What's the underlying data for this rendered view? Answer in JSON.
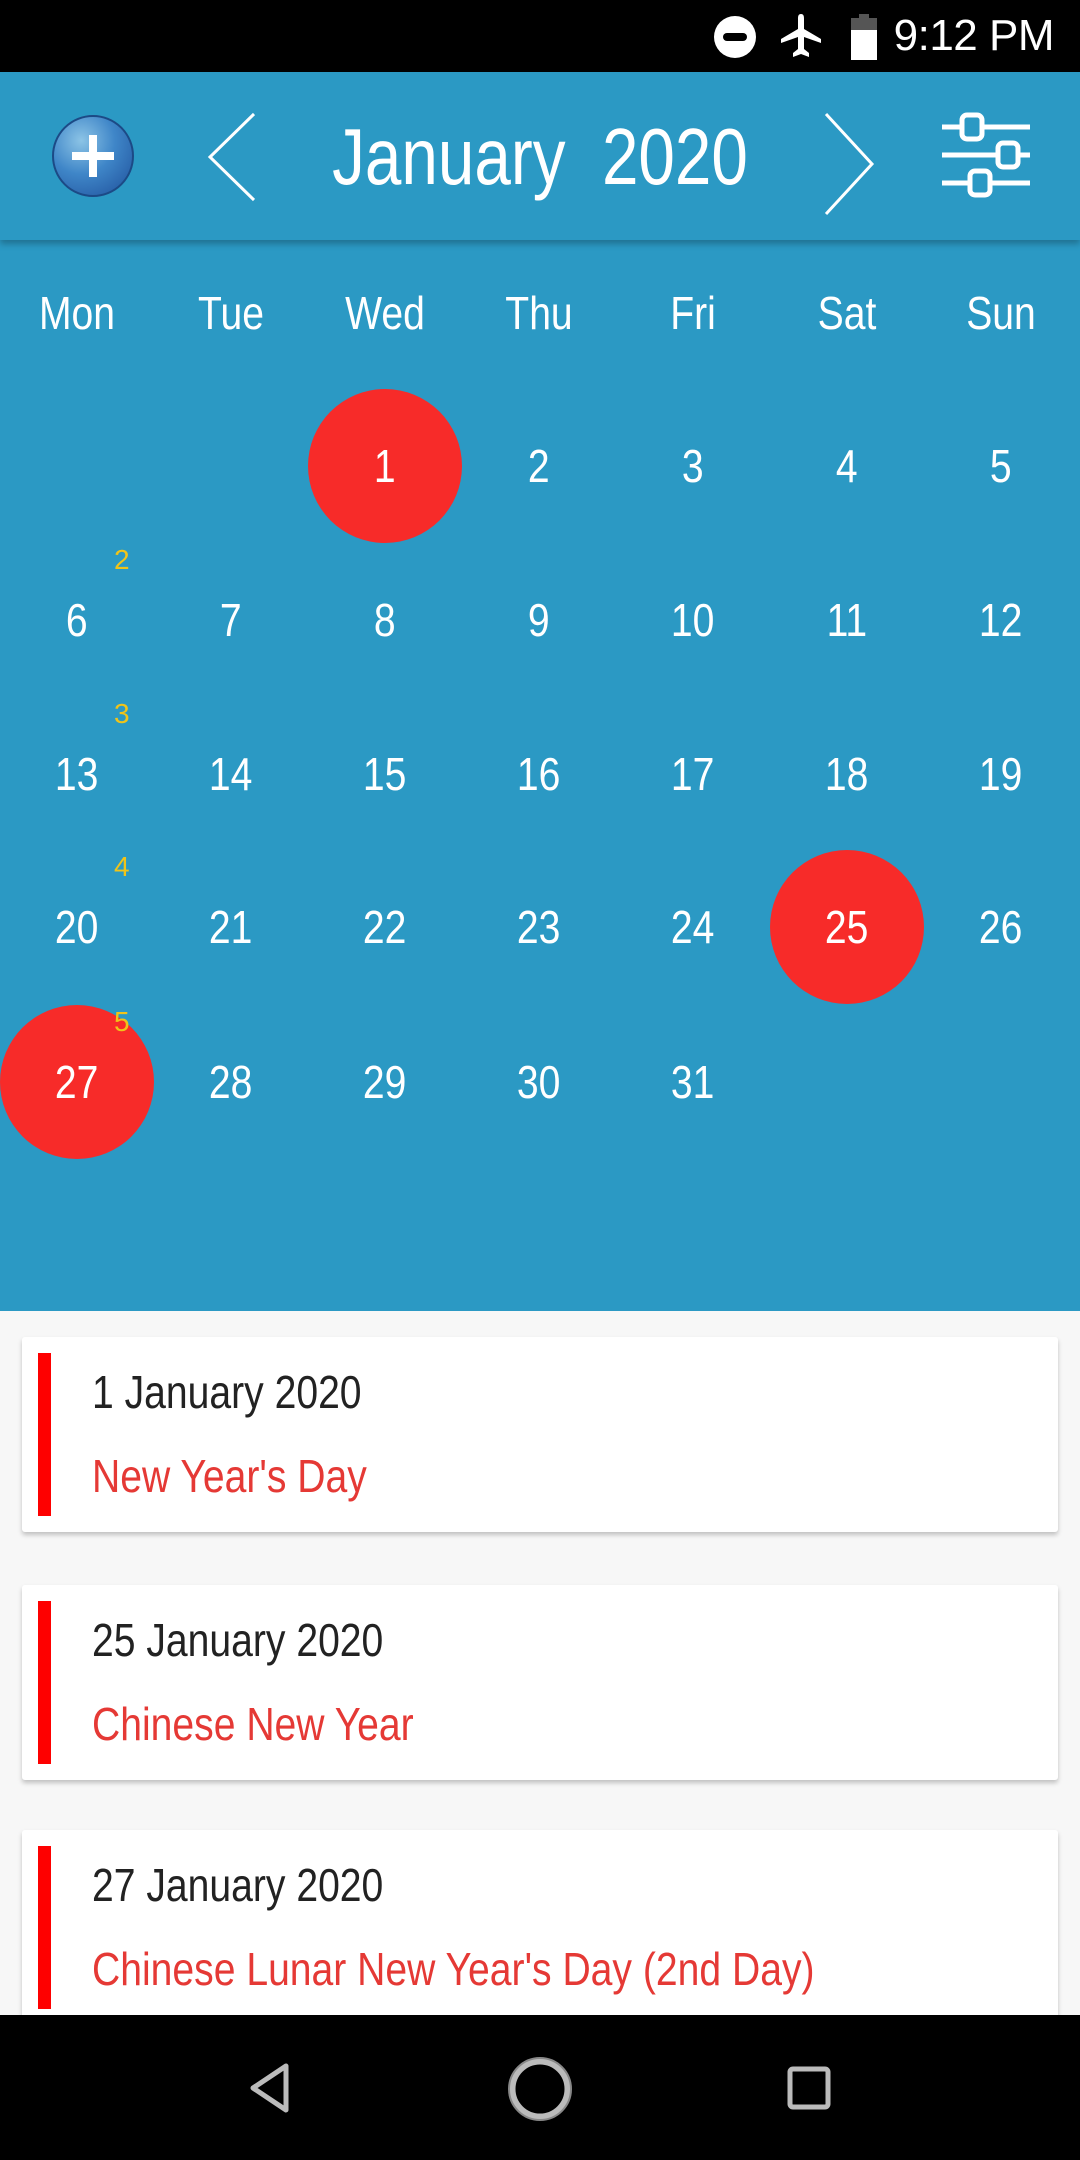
{
  "status_bar": {
    "time": "9:12 PM",
    "icons": [
      "do-not-disturb-icon",
      "airplane-mode-icon",
      "battery-icon"
    ]
  },
  "header": {
    "add_button": "add-icon",
    "prev_button": "chevron-left-icon",
    "title": "January  2020",
    "next_button": "chevron-right-icon",
    "settings_button": "sliders-icon"
  },
  "calendar": {
    "weekdays": [
      "Mon",
      "Tue",
      "Wed",
      "Thu",
      "Fri",
      "Sat",
      "Sun"
    ],
    "weeks": [
      {
        "week_number": "",
        "days": [
          "",
          "",
          "1",
          "2",
          "3",
          "4",
          "5"
        ]
      },
      {
        "week_number": "2",
        "days": [
          "6",
          "7",
          "8",
          "9",
          "10",
          "11",
          "12"
        ]
      },
      {
        "week_number": "3",
        "days": [
          "13",
          "14",
          "15",
          "16",
          "17",
          "18",
          "19"
        ]
      },
      {
        "week_number": "4",
        "days": [
          "20",
          "21",
          "22",
          "23",
          "24",
          "25",
          "26"
        ]
      },
      {
        "week_number": "5",
        "days": [
          "27",
          "28",
          "29",
          "30",
          "31",
          "",
          ""
        ]
      }
    ],
    "highlighted_days": [
      "1",
      "25",
      "27"
    ],
    "colors": {
      "background": "#2b99c4",
      "holiday": "#f72b29",
      "week_number": "#f0c419"
    }
  },
  "events": [
    {
      "date": "1 January 2020",
      "name": "New Year's Day"
    },
    {
      "date": "25 January 2020",
      "name": "Chinese New Year"
    },
    {
      "date": "27 January 2020",
      "name": "Chinese Lunar New Year's Day (2nd Day)"
    }
  ],
  "nav_bar": {
    "buttons": [
      "back-icon",
      "home-icon",
      "recents-icon"
    ]
  }
}
